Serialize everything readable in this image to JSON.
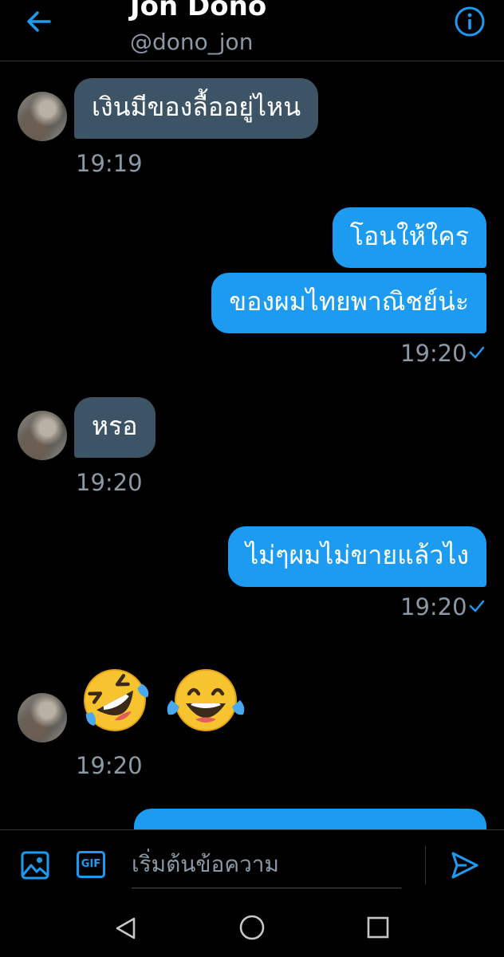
{
  "header": {
    "title": "Jon Dono",
    "handle": "@dono_jon"
  },
  "messages": [
    {
      "direction": "received",
      "text": "เงินมีของลื้ออยู่ไหน",
      "time": "19:19"
    },
    {
      "direction": "sent",
      "text": "โอนให้ใคร"
    },
    {
      "direction": "sent",
      "text": "ของผมไทยพาณิชย์น่ะ",
      "time": "19:20",
      "read": true
    },
    {
      "direction": "received",
      "text": "หรอ",
      "time": "19:20"
    },
    {
      "direction": "sent",
      "text": "ไม่ๆผมไม่ขายแล้วไง",
      "time": "19:20",
      "read": true
    },
    {
      "direction": "received",
      "emojis": [
        "rolling-on-floor-laughing",
        "face-with-tears-of-joy"
      ],
      "time": "19:20"
    },
    {
      "direction": "sent",
      "partial": true
    }
  ],
  "composer": {
    "placeholder": "เริ่มต้นข้อความ",
    "gif_label": "GIF"
  },
  "colors": {
    "accent": "#1d9bf0",
    "received_bubble": "#3d5466",
    "muted_text": "#8b98a5",
    "background": "#000000"
  }
}
